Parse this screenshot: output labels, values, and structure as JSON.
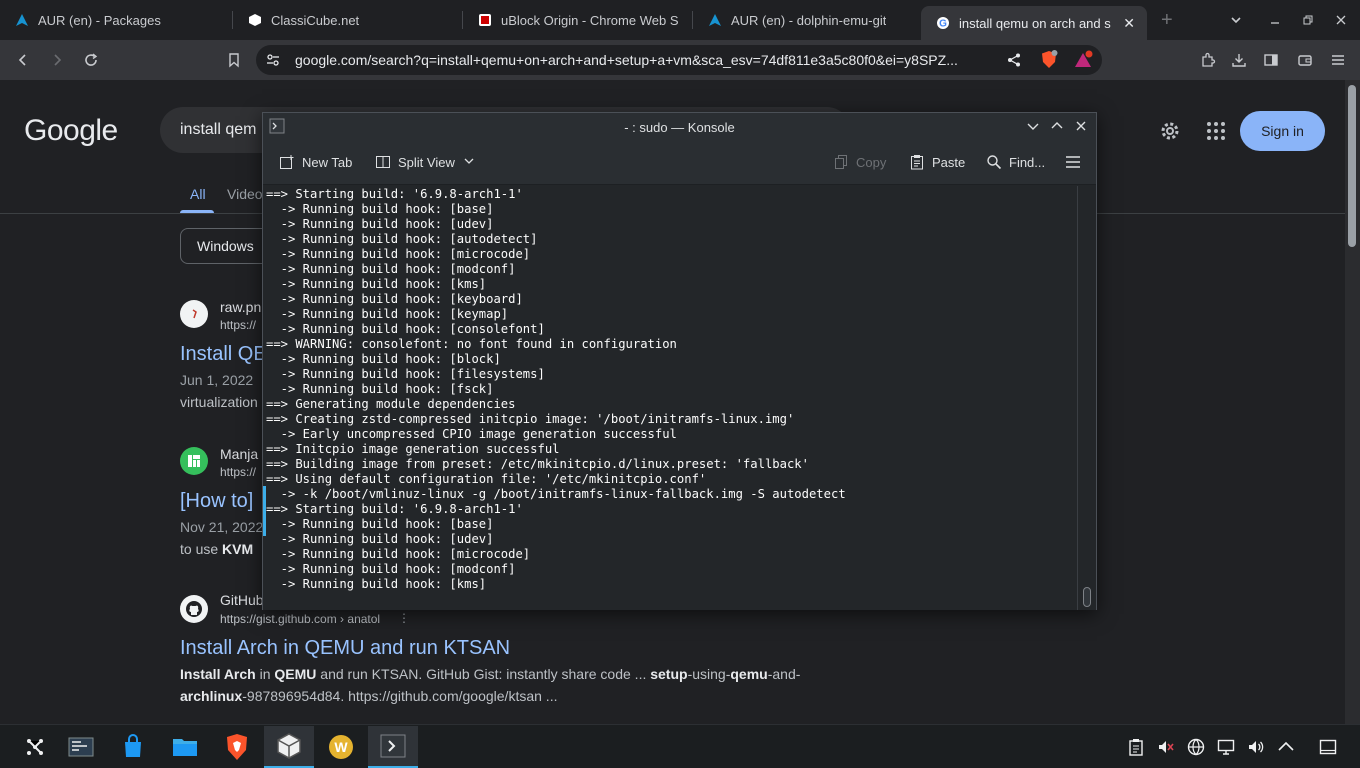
{
  "browser": {
    "tabs": [
      {
        "title": "AUR (en) - Packages",
        "icon": "arch-icon"
      },
      {
        "title": "ClassiCube.net",
        "icon": "cube-icon"
      },
      {
        "title": "uBlock Origin - Chrome Web S",
        "icon": "ublock-icon"
      },
      {
        "title": "AUR (en) - dolphin-emu-git",
        "icon": "arch-icon"
      },
      {
        "title": "install qemu on arch and s",
        "icon": "google-icon",
        "active": true
      }
    ],
    "url": "google.com/search?q=install+qemu+on+arch+and+setup+a+vm&sca_esv=74df811e3a5c80f0&ei=y8SPZ..."
  },
  "google": {
    "logo": "Google",
    "query": "install qem",
    "sign_in": "Sign in",
    "tabs": {
      "all": "All",
      "videos": "Videos"
    },
    "chip": "Windows"
  },
  "results": [
    {
      "site": "raw.pn",
      "url": "https://",
      "title": "Install QE",
      "date": "Jun 1, 2022",
      "snippet": "virtualization"
    },
    {
      "site": "Manja",
      "url": "https://",
      "title": "[How to]",
      "date": "Nov 21, 2022",
      "snippet_pre": "to use ",
      "snippet_bold": "KVM"
    },
    {
      "site": "GitHub",
      "url": "https://gist.github.com › anatol",
      "title": "Install Arch in QEMU and run KTSAN",
      "snippet_l1": [
        {
          "t": "Install Arch",
          "b": true
        },
        {
          "t": " in ",
          "b": false
        },
        {
          "t": "QEMU",
          "b": true
        },
        {
          "t": " and run KTSAN. GitHub Gist: instantly share code ... ",
          "b": false
        },
        {
          "t": "setup",
          "b": true
        },
        {
          "t": "-using-",
          "b": false
        },
        {
          "t": "qemu",
          "b": true
        },
        {
          "t": "-and-",
          "b": false
        }
      ],
      "snippet_l2": [
        {
          "t": "archlinux",
          "b": true
        },
        {
          "t": "-987896954d84. https://github.com/google/ktsan ...",
          "b": false
        }
      ]
    }
  ],
  "konsole": {
    "title": "- : sudo — Konsole",
    "toolbar": {
      "new_tab": "New Tab",
      "split_view": "Split View",
      "copy": "Copy",
      "paste": "Paste",
      "find": "Find..."
    },
    "lines": [
      "==> Starting build: '6.9.8-arch1-1'",
      "  -> Running build hook: [base]",
      "  -> Running build hook: [udev]",
      "  -> Running build hook: [autodetect]",
      "  -> Running build hook: [microcode]",
      "  -> Running build hook: [modconf]",
      "  -> Running build hook: [kms]",
      "  -> Running build hook: [keyboard]",
      "  -> Running build hook: [keymap]",
      "  -> Running build hook: [consolefont]",
      "==> WARNING: consolefont: no font found in configuration",
      "  -> Running build hook: [block]",
      "  -> Running build hook: [filesystems]",
      "  -> Running build hook: [fsck]",
      "==> Generating module dependencies",
      "==> Creating zstd-compressed initcpio image: '/boot/initramfs-linux.img'",
      "  -> Early uncompressed CPIO image generation successful",
      "==> Initcpio image generation successful",
      "==> Building image from preset: /etc/mkinitcpio.d/linux.preset: 'fallback'",
      "==> Using default configuration file: '/etc/mkinitcpio.conf'",
      "  -> -k /boot/vmlinuz-linux -g /boot/initramfs-linux-fallback.img -S autodetect",
      "==> Starting build: '6.9.8-arch1-1'",
      "  -> Running build hook: [base]",
      "  -> Running build hook: [udev]",
      "  -> Running build hook: [microcode]",
      "  -> Running build hook: [modconf]",
      "  -> Running build hook: [kms]"
    ]
  },
  "taskbar": {
    "apps": [
      "app-launcher-icon",
      "pager-icon",
      "discover-icon",
      "dolphin-icon",
      "brave-icon",
      "virtualbox-icon",
      "wps-icon",
      "konsole-icon"
    ],
    "tray": [
      "clipboard-icon",
      "audio-muted-icon",
      "network-icon",
      "display-icon",
      "volume-icon",
      "tray-expand-icon",
      "show-desktop-icon"
    ]
  },
  "colors": {
    "accent": "#3daee9",
    "google_link": "#99c3ff",
    "signin": "#8ab4f8"
  }
}
